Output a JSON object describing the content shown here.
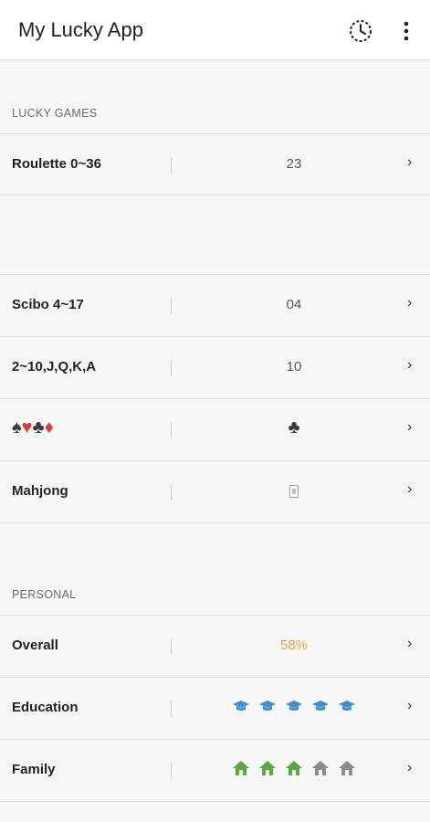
{
  "app": {
    "title": "My Lucky App"
  },
  "sections": {
    "lucky_games": "LUCKY GAMES",
    "personal": "PERSONAL"
  },
  "games": [
    {
      "label": "Roulette 0~36",
      "value": "23"
    },
    {
      "label": "Scibo 4~17",
      "value": "04"
    },
    {
      "label": "2~10,J,Q,K,A",
      "value": "10"
    },
    {
      "label": "suits",
      "value": "club-icon"
    },
    {
      "label": "Mahjong",
      "value": "mahjong-tile-icon"
    }
  ],
  "personal": [
    {
      "label": "Overall",
      "value": "58%"
    },
    {
      "label": "Education",
      "rating": 5,
      "max": 5,
      "icon": "graduation-cap-icon"
    },
    {
      "label": "Family",
      "rating": 3,
      "max": 5,
      "icon": "house-icon"
    }
  ],
  "chevron": "›",
  "colors": {
    "accent": "#f0a040",
    "education": "#3c8fd0",
    "family_on": "#5aa843",
    "family_off": "#8c8c8c",
    "suit_red": "#e53935"
  }
}
